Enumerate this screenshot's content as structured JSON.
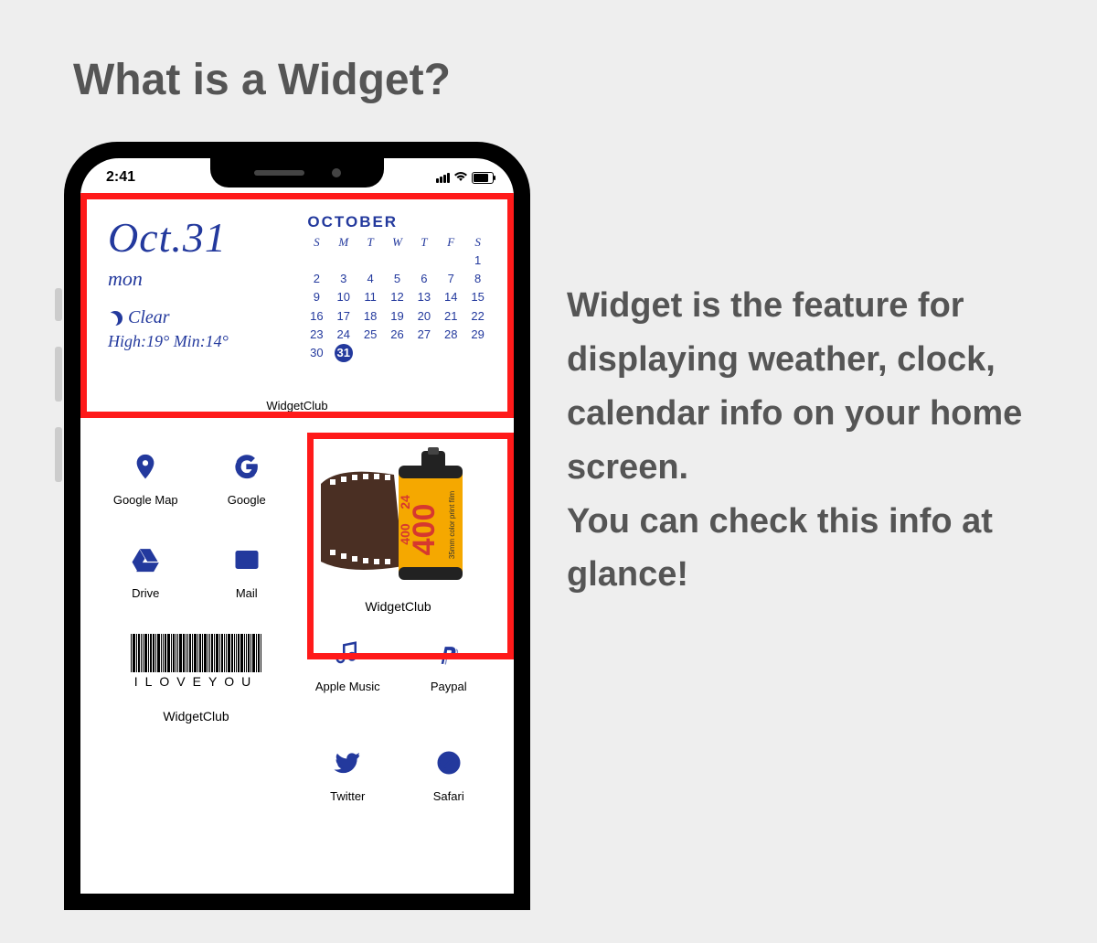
{
  "heading": "What is a Widget?",
  "description_l1": "Widget is the feature for displaying weather, clock, calendar info on your home screen.",
  "description_l2": "You can check this info at glance!",
  "statusbar": {
    "time": "2:41"
  },
  "calendar": {
    "date": "Oct.31",
    "day": "mon",
    "weather": "Clear",
    "temps": "High:19° Min:14°",
    "month": "OCTOBER",
    "dow": [
      "S",
      "M",
      "T",
      "W",
      "T",
      "F",
      "S"
    ],
    "days": [
      "",
      "",
      "",
      "",
      "",
      "",
      "1",
      "2",
      "3",
      "4",
      "5",
      "6",
      "7",
      "8",
      "9",
      "10",
      "11",
      "12",
      "13",
      "14",
      "15",
      "16",
      "17",
      "18",
      "19",
      "20",
      "21",
      "22",
      "23",
      "24",
      "25",
      "26",
      "27",
      "28",
      "29",
      "30",
      "31"
    ],
    "today": "31",
    "label": "WidgetClub"
  },
  "apps": {
    "map": "Google Map",
    "google": "Google",
    "drive": "Drive",
    "mail": "Mail",
    "music": "Apple Music",
    "paypal": "Paypal",
    "twitter": "Twitter",
    "safari": "Safari"
  },
  "film": {
    "label": "WidgetClub",
    "badge1": "400",
    "badge2": "400",
    "badge3": "24",
    "badge4": "35mm color print film"
  },
  "barcode": {
    "text": "ILOVEYOU",
    "label": "WidgetClub"
  }
}
